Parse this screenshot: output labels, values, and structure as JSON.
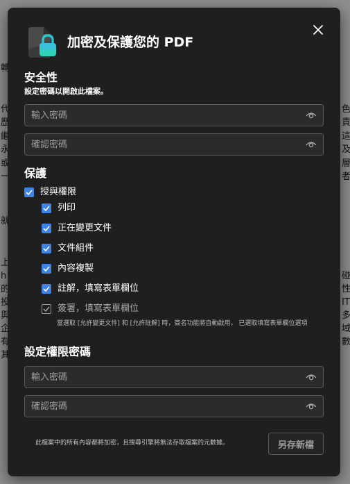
{
  "background": {
    "left_chars": [
      "轉",
      "代",
      "歷",
      "繼",
      "永",
      "或",
      "一",
      "就",
      "上",
      "h",
      "的",
      "投",
      "與",
      "企",
      "有",
      "其"
    ],
    "right_chars": [
      "色",
      "責",
      "這",
      "及",
      "層",
      "者",
      "碰",
      "性",
      "IT",
      "多",
      "域",
      "數"
    ]
  },
  "dialog": {
    "title": "加密及保護您的 PDF",
    "close_icon": "close-icon",
    "logo_icon": "lock-file-icon",
    "accent_color": "#3f83e5"
  },
  "security": {
    "heading": "安全性",
    "subtitle": "設定密碼以開啟此檔案。",
    "password_placeholder": "輸入密碼",
    "confirm_placeholder": "確認密碼",
    "eye_icon": "eye-icon"
  },
  "protection": {
    "heading": "保護",
    "grant_label": "授與權限",
    "permissions": [
      {
        "label": "列印",
        "checked": true
      },
      {
        "label": "正在變更文件",
        "checked": true
      },
      {
        "label": "文件組件",
        "checked": true
      },
      {
        "label": "內容複製",
        "checked": true
      },
      {
        "label": "註解，填寫表單欄位",
        "checked": true
      },
      {
        "label": "簽署，填寫表單欄位",
        "checked": true,
        "disabled": true
      }
    ],
    "note": "當選取 [允許變更文件] 和 [允許註解] 時，簽名功能將自動啟用， 已選取填寫表單欄位選項"
  },
  "permission_password": {
    "heading": "設定權限密碼",
    "password_placeholder": "輸入密碼",
    "confirm_placeholder": "確認密碼"
  },
  "footer": {
    "note": "此檔案中的所有內容都將加密，且搜尋引擎將無法存取檔案的元數據。",
    "save_label": "另存新檔"
  }
}
